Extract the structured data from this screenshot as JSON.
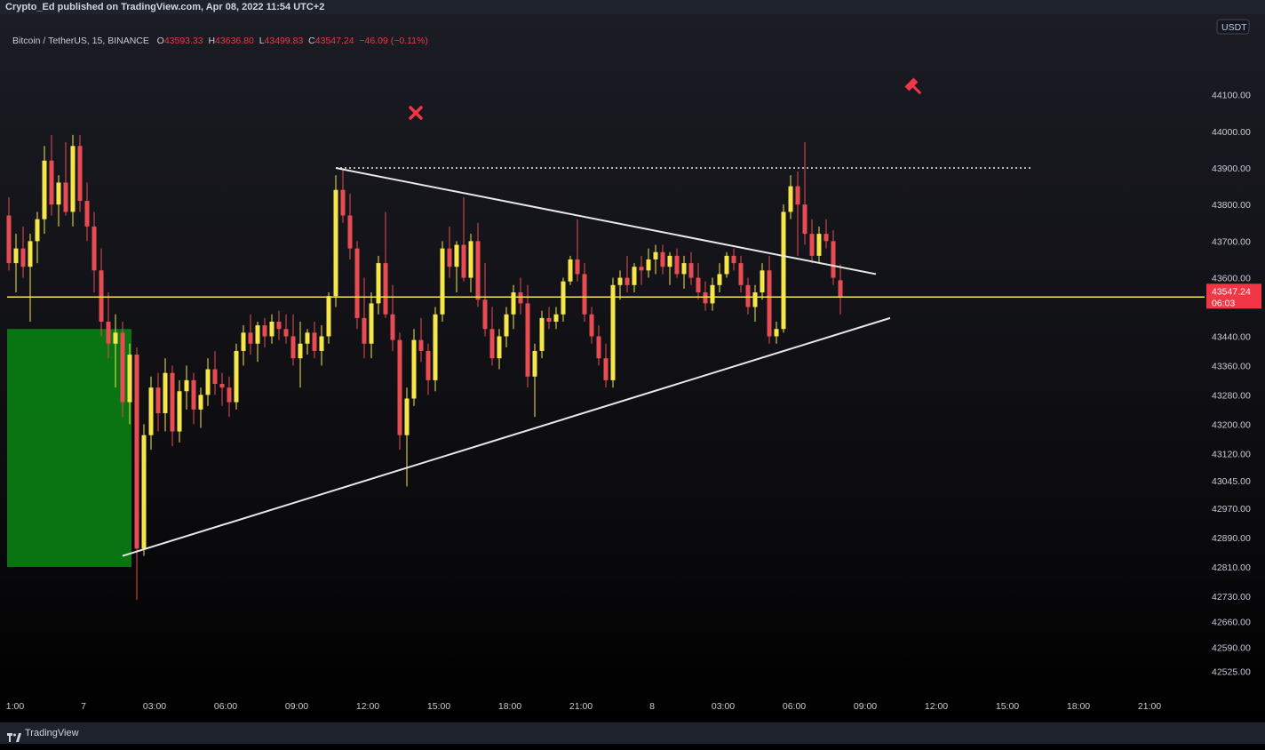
{
  "header": {
    "title": "Crypto_Ed published on TradingView.com, Apr 08, 2022 11:54 UTC+2"
  },
  "legend": {
    "symbol": "Bitcoin / TetherUS, 15, BINANCE",
    "o_label": "O",
    "o": "43593.33",
    "h_label": "H",
    "h": "43636.80",
    "l_label": "L",
    "l": "43499.83",
    "c_label": "C",
    "c": "43547.24",
    "change": "−46.09 (−0.11%)"
  },
  "footer": {
    "brand": "TradingView"
  },
  "colors": {
    "up": "#f5e64a",
    "down": "#e84c52",
    "price_line": "#f5e64a",
    "zone": "#0a7a12",
    "badge": "#f23645"
  },
  "chart_data": {
    "type": "candlestick",
    "symbol": "BTCUSDT",
    "timeframe": "15",
    "exchange": "BINANCE",
    "currency_label": "USDT",
    "ylim": [
      42470,
      44320
    ],
    "y_ticks": [
      "44100.00",
      "44000.00",
      "43900.00",
      "43800.00",
      "43700.00",
      "43600.00",
      "43440.00",
      "43360.00",
      "43280.00",
      "43200.00",
      "43120.00",
      "43045.00",
      "42970.00",
      "42890.00",
      "42810.00",
      "42730.00",
      "42660.00",
      "42590.00",
      "42525.00"
    ],
    "x_ticks": [
      "1:00",
      "7",
      "03:00",
      "06:00",
      "09:00",
      "12:00",
      "15:00",
      "18:00",
      "21:00",
      "8",
      "03:00",
      "06:00",
      "09:00",
      "12:00",
      "15:00",
      "18:00",
      "21:00"
    ],
    "current_price": {
      "value": "43547.24",
      "countdown": "06:03"
    },
    "candles": [
      {
        "o": 43770,
        "h": 43820,
        "l": 43620,
        "c": 43640
      },
      {
        "o": 43640,
        "h": 43720,
        "l": 43560,
        "c": 43680
      },
      {
        "o": 43680,
        "h": 43740,
        "l": 43600,
        "c": 43630
      },
      {
        "o": 43630,
        "h": 43720,
        "l": 43480,
        "c": 43700
      },
      {
        "o": 43700,
        "h": 43780,
        "l": 43640,
        "c": 43760
      },
      {
        "o": 43760,
        "h": 43960,
        "l": 43720,
        "c": 43920
      },
      {
        "o": 43920,
        "h": 43990,
        "l": 43770,
        "c": 43800
      },
      {
        "o": 43800,
        "h": 43880,
        "l": 43740,
        "c": 43860
      },
      {
        "o": 43860,
        "h": 43970,
        "l": 43770,
        "c": 43780
      },
      {
        "o": 43780,
        "h": 43990,
        "l": 43740,
        "c": 43960
      },
      {
        "o": 43960,
        "h": 43990,
        "l": 43780,
        "c": 43810
      },
      {
        "o": 43810,
        "h": 43860,
        "l": 43700,
        "c": 43740
      },
      {
        "o": 43740,
        "h": 43780,
        "l": 43560,
        "c": 43620
      },
      {
        "o": 43620,
        "h": 43680,
        "l": 43440,
        "c": 43480
      },
      {
        "o": 43480,
        "h": 43560,
        "l": 43380,
        "c": 43420
      },
      {
        "o": 43420,
        "h": 43500,
        "l": 43300,
        "c": 43450
      },
      {
        "o": 43450,
        "h": 43480,
        "l": 43220,
        "c": 43260
      },
      {
        "o": 43260,
        "h": 43420,
        "l": 43200,
        "c": 43390
      },
      {
        "o": 43390,
        "h": 43410,
        "l": 42720,
        "c": 42860
      },
      {
        "o": 42860,
        "h": 43200,
        "l": 42840,
        "c": 43170
      },
      {
        "o": 43170,
        "h": 43330,
        "l": 43130,
        "c": 43300
      },
      {
        "o": 43300,
        "h": 43340,
        "l": 43180,
        "c": 43230
      },
      {
        "o": 43230,
        "h": 43380,
        "l": 43180,
        "c": 43340
      },
      {
        "o": 43340,
        "h": 43360,
        "l": 43140,
        "c": 43180
      },
      {
        "o": 43180,
        "h": 43320,
        "l": 43150,
        "c": 43290
      },
      {
        "o": 43290,
        "h": 43360,
        "l": 43240,
        "c": 43320
      },
      {
        "o": 43320,
        "h": 43340,
        "l": 43200,
        "c": 43240
      },
      {
        "o": 43240,
        "h": 43300,
        "l": 43190,
        "c": 43280
      },
      {
        "o": 43280,
        "h": 43380,
        "l": 43250,
        "c": 43350
      },
      {
        "o": 43350,
        "h": 43400,
        "l": 43280,
        "c": 43310
      },
      {
        "o": 43310,
        "h": 43340,
        "l": 43250,
        "c": 43300
      },
      {
        "o": 43300,
        "h": 43330,
        "l": 43220,
        "c": 43260
      },
      {
        "o": 43260,
        "h": 43420,
        "l": 43240,
        "c": 43400
      },
      {
        "o": 43400,
        "h": 43470,
        "l": 43360,
        "c": 43450
      },
      {
        "o": 43450,
        "h": 43500,
        "l": 43390,
        "c": 43420
      },
      {
        "o": 43420,
        "h": 43480,
        "l": 43370,
        "c": 43470
      },
      {
        "o": 43470,
        "h": 43490,
        "l": 43410,
        "c": 43440
      },
      {
        "o": 43440,
        "h": 43500,
        "l": 43420,
        "c": 43480
      },
      {
        "o": 43480,
        "h": 43510,
        "l": 43430,
        "c": 43460
      },
      {
        "o": 43460,
        "h": 43500,
        "l": 43420,
        "c": 43440
      },
      {
        "o": 43440,
        "h": 43500,
        "l": 43360,
        "c": 43380
      },
      {
        "o": 43380,
        "h": 43480,
        "l": 43300,
        "c": 43420
      },
      {
        "o": 43420,
        "h": 43460,
        "l": 43390,
        "c": 43450
      },
      {
        "o": 43450,
        "h": 43480,
        "l": 43380,
        "c": 43400
      },
      {
        "o": 43400,
        "h": 43470,
        "l": 43360,
        "c": 43440
      },
      {
        "o": 43440,
        "h": 43560,
        "l": 43420,
        "c": 43550
      },
      {
        "o": 43550,
        "h": 43880,
        "l": 43520,
        "c": 43840
      },
      {
        "o": 43840,
        "h": 43900,
        "l": 43750,
        "c": 43770
      },
      {
        "o": 43770,
        "h": 43830,
        "l": 43650,
        "c": 43680
      },
      {
        "o": 43680,
        "h": 43700,
        "l": 43460,
        "c": 43490
      },
      {
        "o": 43490,
        "h": 43600,
        "l": 43380,
        "c": 43420
      },
      {
        "o": 43420,
        "h": 43560,
        "l": 43380,
        "c": 43530
      },
      {
        "o": 43530,
        "h": 43660,
        "l": 43500,
        "c": 43640
      },
      {
        "o": 43640,
        "h": 43780,
        "l": 43490,
        "c": 43500
      },
      {
        "o": 43500,
        "h": 43580,
        "l": 43400,
        "c": 43430
      },
      {
        "o": 43430,
        "h": 43450,
        "l": 43130,
        "c": 43170
      },
      {
        "o": 43170,
        "h": 43300,
        "l": 43030,
        "c": 43270
      },
      {
        "o": 43270,
        "h": 43460,
        "l": 43250,
        "c": 43430
      },
      {
        "o": 43430,
        "h": 43490,
        "l": 43370,
        "c": 43400
      },
      {
        "o": 43400,
        "h": 43420,
        "l": 43280,
        "c": 43320
      },
      {
        "o": 43320,
        "h": 43520,
        "l": 43290,
        "c": 43500
      },
      {
        "o": 43500,
        "h": 43700,
        "l": 43480,
        "c": 43680
      },
      {
        "o": 43680,
        "h": 43740,
        "l": 43600,
        "c": 43630
      },
      {
        "o": 43630,
        "h": 43700,
        "l": 43560,
        "c": 43690
      },
      {
        "o": 43690,
        "h": 43820,
        "l": 43590,
        "c": 43600
      },
      {
        "o": 43600,
        "h": 43720,
        "l": 43560,
        "c": 43700
      },
      {
        "o": 43700,
        "h": 43750,
        "l": 43520,
        "c": 43540
      },
      {
        "o": 43540,
        "h": 43640,
        "l": 43440,
        "c": 43460
      },
      {
        "o": 43460,
        "h": 43520,
        "l": 43360,
        "c": 43380
      },
      {
        "o": 43380,
        "h": 43460,
        "l": 43350,
        "c": 43440
      },
      {
        "o": 43440,
        "h": 43520,
        "l": 43410,
        "c": 43500
      },
      {
        "o": 43500,
        "h": 43580,
        "l": 43460,
        "c": 43560
      },
      {
        "o": 43560,
        "h": 43600,
        "l": 43500,
        "c": 43530
      },
      {
        "o": 43530,
        "h": 43580,
        "l": 43300,
        "c": 43330
      },
      {
        "o": 43330,
        "h": 43420,
        "l": 43220,
        "c": 43400
      },
      {
        "o": 43400,
        "h": 43510,
        "l": 43380,
        "c": 43490
      },
      {
        "o": 43490,
        "h": 43520,
        "l": 43460,
        "c": 43480
      },
      {
        "o": 43480,
        "h": 43520,
        "l": 43460,
        "c": 43500
      },
      {
        "o": 43500,
        "h": 43600,
        "l": 43480,
        "c": 43590
      },
      {
        "o": 43590,
        "h": 43660,
        "l": 43580,
        "c": 43650
      },
      {
        "o": 43650,
        "h": 43760,
        "l": 43590,
        "c": 43610
      },
      {
        "o": 43610,
        "h": 43640,
        "l": 43480,
        "c": 43500
      },
      {
        "o": 43500,
        "h": 43520,
        "l": 43420,
        "c": 43440
      },
      {
        "o": 43440,
        "h": 43470,
        "l": 43360,
        "c": 43380
      },
      {
        "o": 43380,
        "h": 43420,
        "l": 43300,
        "c": 43320
      },
      {
        "o": 43320,
        "h": 43600,
        "l": 43300,
        "c": 43580
      },
      {
        "o": 43580,
        "h": 43620,
        "l": 43540,
        "c": 43600
      },
      {
        "o": 43600,
        "h": 43660,
        "l": 43560,
        "c": 43580
      },
      {
        "o": 43580,
        "h": 43640,
        "l": 43560,
        "c": 43630
      },
      {
        "o": 43630,
        "h": 43660,
        "l": 43580,
        "c": 43620
      },
      {
        "o": 43620,
        "h": 43680,
        "l": 43600,
        "c": 43650
      },
      {
        "o": 43650,
        "h": 43690,
        "l": 43610,
        "c": 43670
      },
      {
        "o": 43670,
        "h": 43690,
        "l": 43610,
        "c": 43630
      },
      {
        "o": 43630,
        "h": 43670,
        "l": 43580,
        "c": 43660
      },
      {
        "o": 43660,
        "h": 43680,
        "l": 43600,
        "c": 43610
      },
      {
        "o": 43610,
        "h": 43660,
        "l": 43570,
        "c": 43640
      },
      {
        "o": 43640,
        "h": 43670,
        "l": 43580,
        "c": 43600
      },
      {
        "o": 43600,
        "h": 43640,
        "l": 43540,
        "c": 43560
      },
      {
        "o": 43560,
        "h": 43590,
        "l": 43510,
        "c": 43530
      },
      {
        "o": 43530,
        "h": 43600,
        "l": 43510,
        "c": 43580
      },
      {
        "o": 43580,
        "h": 43640,
        "l": 43560,
        "c": 43610
      },
      {
        "o": 43610,
        "h": 43670,
        "l": 43600,
        "c": 43660
      },
      {
        "o": 43660,
        "h": 43680,
        "l": 43620,
        "c": 43640
      },
      {
        "o": 43640,
        "h": 43660,
        "l": 43560,
        "c": 43580
      },
      {
        "o": 43580,
        "h": 43600,
        "l": 43500,
        "c": 43520
      },
      {
        "o": 43520,
        "h": 43580,
        "l": 43480,
        "c": 43560
      },
      {
        "o": 43560,
        "h": 43640,
        "l": 43540,
        "c": 43620
      },
      {
        "o": 43620,
        "h": 43660,
        "l": 43420,
        "c": 43440
      },
      {
        "o": 43440,
        "h": 43480,
        "l": 43420,
        "c": 43460
      },
      {
        "o": 43460,
        "h": 43800,
        "l": 43450,
        "c": 43780
      },
      {
        "o": 43780,
        "h": 43880,
        "l": 43760,
        "c": 43850
      },
      {
        "o": 43850,
        "h": 43890,
        "l": 43660,
        "c": 43800
      },
      {
        "o": 43800,
        "h": 43970,
        "l": 43690,
        "c": 43720
      },
      {
        "o": 43720,
        "h": 43760,
        "l": 43640,
        "c": 43660
      },
      {
        "o": 43660,
        "h": 43740,
        "l": 43640,
        "c": 43720
      },
      {
        "o": 43720,
        "h": 43760,
        "l": 43680,
        "c": 43700
      },
      {
        "o": 43700,
        "h": 43730,
        "l": 43580,
        "c": 43600
      },
      {
        "o": 43593.33,
        "h": 43636.8,
        "l": 43499.83,
        "c": 43547.24
      }
    ],
    "demand_zone": {
      "y_top": 43460,
      "y_bottom": 42810
    },
    "trendlines": [
      {
        "name": "descending-resistance",
        "from": {
          "i": 46,
          "y": 43900
        },
        "to": {
          "i": 122,
          "y": 43610
        }
      },
      {
        "name": "ascending-support",
        "from": {
          "i": 16,
          "y": 42840
        },
        "to": {
          "i": 124,
          "y": 43490
        }
      }
    ],
    "dotted_level": {
      "y": 43900,
      "from_i": 46,
      "to_i": 130
    }
  }
}
